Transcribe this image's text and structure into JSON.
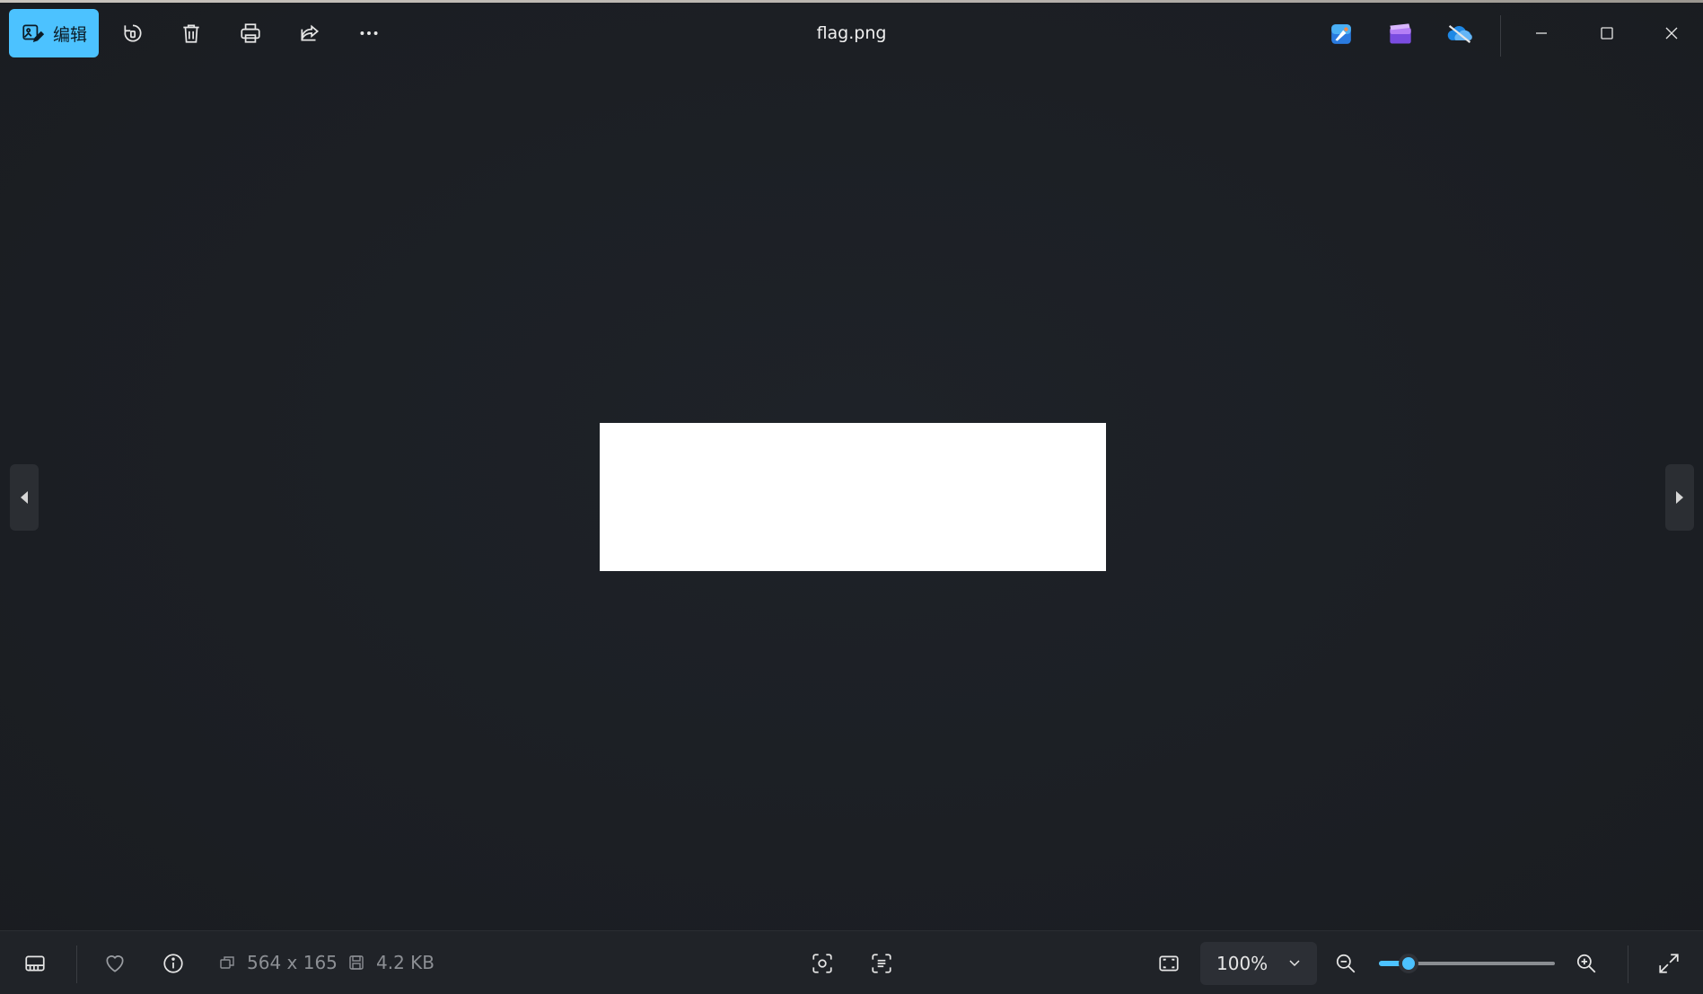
{
  "window": {
    "title": "flag.png"
  },
  "toolbar": {
    "edit_label": "编辑",
    "edit_icon": "edit-image-icon",
    "buttons": [
      "rotate-icon",
      "delete-icon",
      "print-icon",
      "share-icon",
      "more-icon"
    ]
  },
  "app_icons": [
    "paint-app-icon",
    "clipchamp-app-icon",
    "onedrive-icon"
  ],
  "window_controls": [
    "minimize-icon",
    "maximize-icon",
    "close-icon"
  ],
  "status": {
    "dimensions": "564 x 165",
    "file_size": "4.2 KB",
    "zoom_level": "100%",
    "zoom_slider_fraction": 0.17
  },
  "colors": {
    "accent": "#4cc2ff",
    "background": "#1c1f24",
    "bottom_bar": "#202328"
  }
}
